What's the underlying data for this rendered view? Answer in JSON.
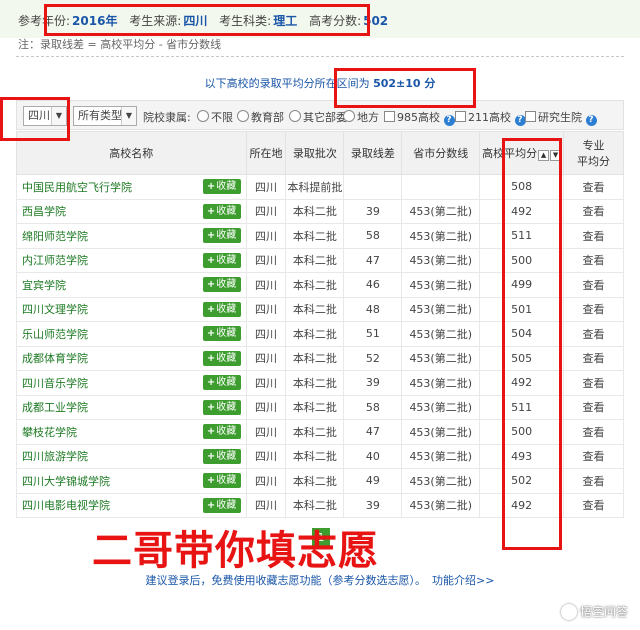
{
  "header": {
    "year_label": "参考年份:",
    "year_value": "2016年",
    "source_label": "考生来源:",
    "source_value": "四川",
    "subject_label": "考生科类:",
    "subject_value": "理工",
    "score_label": "高考分数:",
    "score_value": "502",
    "note": "注：录取线差 = 高校平均分 - 省市分数线"
  },
  "range": {
    "prefix": "以下高校的录取平均分所在区间为",
    "value": "502±10 分"
  },
  "filters": {
    "province_select": "四川",
    "type_select": "所有类型",
    "affiliation_label": "院校隶属:",
    "radio_options": [
      "不限",
      "教育部",
      "其它部委",
      "地方"
    ],
    "check_985": "985高校",
    "check_211": "211高校",
    "check_grad": "研究生院"
  },
  "table": {
    "headers": {
      "name": "高校名称",
      "location": "所在地",
      "batch": "录取批次",
      "diff": "录取线差",
      "province_line": "省市分数线",
      "avg": "高校平均分",
      "major_avg_1": "专业",
      "major_avg_2": "平均分"
    },
    "fav_label": "收藏",
    "view_label": "查看",
    "rows": [
      {
        "name": "中国民用航空飞行学院",
        "location": "四川",
        "batch": "本科提前批",
        "diff": "",
        "line": "",
        "avg": "508"
      },
      {
        "name": "西昌学院",
        "location": "四川",
        "batch": "本科二批",
        "diff": "39",
        "line": "453(第二批)",
        "avg": "492"
      },
      {
        "name": "绵阳师范学院",
        "location": "四川",
        "batch": "本科二批",
        "diff": "58",
        "line": "453(第二批)",
        "avg": "511"
      },
      {
        "name": "内江师范学院",
        "location": "四川",
        "batch": "本科二批",
        "diff": "47",
        "line": "453(第二批)",
        "avg": "500"
      },
      {
        "name": "宜宾学院",
        "location": "四川",
        "batch": "本科二批",
        "diff": "46",
        "line": "453(第二批)",
        "avg": "499"
      },
      {
        "name": "四川文理学院",
        "location": "四川",
        "batch": "本科二批",
        "diff": "48",
        "line": "453(第二批)",
        "avg": "501"
      },
      {
        "name": "乐山师范学院",
        "location": "四川",
        "batch": "本科二批",
        "diff": "51",
        "line": "453(第二批)",
        "avg": "504"
      },
      {
        "name": "成都体育学院",
        "location": "四川",
        "batch": "本科二批",
        "diff": "52",
        "line": "453(第二批)",
        "avg": "505"
      },
      {
        "name": "四川音乐学院",
        "location": "四川",
        "batch": "本科二批",
        "diff": "39",
        "line": "453(第二批)",
        "avg": "492"
      },
      {
        "name": "成都工业学院",
        "location": "四川",
        "batch": "本科二批",
        "diff": "58",
        "line": "453(第二批)",
        "avg": "511"
      },
      {
        "name": "攀枝花学院",
        "location": "四川",
        "batch": "本科二批",
        "diff": "47",
        "line": "453(第二批)",
        "avg": "500"
      },
      {
        "name": "四川旅游学院",
        "location": "四川",
        "batch": "本科二批",
        "diff": "40",
        "line": "453(第二批)",
        "avg": "493"
      },
      {
        "name": "四川大学锦城学院",
        "location": "四川",
        "batch": "本科二批",
        "diff": "49",
        "line": "453(第二批)",
        "avg": "502"
      },
      {
        "name": "四川电影电视学院",
        "location": "四川",
        "batch": "本科二批",
        "diff": "39",
        "line": "453(第二批)",
        "avg": "492"
      }
    ]
  },
  "pager": {
    "current": "1"
  },
  "overlay_text": "二哥带你填志愿",
  "footer": {
    "text": "建议登录后，免费使用收藏志愿功能（参考分数选志愿）。",
    "link": "功能介绍>>"
  },
  "brand": "悟空问答",
  "colors": {
    "accent_green": "#3e9d2f",
    "link_blue": "#1a56a8",
    "annotation_red": "#e81414"
  },
  "icons": [
    "dropdown-arrow-icon",
    "help-icon",
    "sort-icon",
    "plus-icon",
    "brand-icon"
  ]
}
